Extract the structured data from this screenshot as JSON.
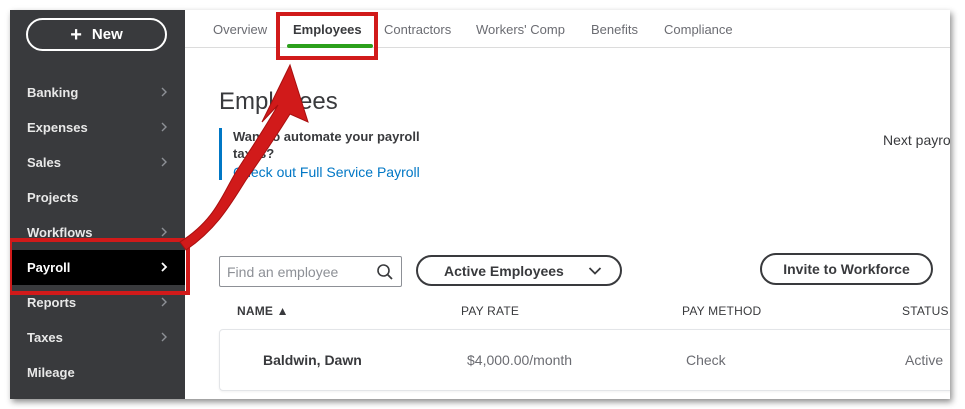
{
  "sidebar": {
    "new_label": "New",
    "items": [
      {
        "label": "Banking"
      },
      {
        "label": "Expenses"
      },
      {
        "label": "Sales"
      },
      {
        "label": "Projects"
      },
      {
        "label": "Workflows"
      },
      {
        "label": "Payroll",
        "active": true
      },
      {
        "label": "Reports"
      },
      {
        "label": "Taxes"
      },
      {
        "label": "Mileage"
      }
    ]
  },
  "tabs": [
    {
      "label": "Overview"
    },
    {
      "label": "Employees",
      "active": true
    },
    {
      "label": "Contractors"
    },
    {
      "label": "Workers' Comp"
    },
    {
      "label": "Benefits"
    },
    {
      "label": "Compliance"
    }
  ],
  "main": {
    "title": "Employees",
    "promo_text": "Want to automate your payroll taxes?",
    "promo_link": "Check out Full Service Payroll",
    "next_payroll": "Next payro",
    "search_placeholder": "Find an employee",
    "filter_label": "Active Employees",
    "invite_label": "Invite to Workforce",
    "columns": {
      "name": "NAME ▲",
      "pay_rate": "PAY RATE",
      "pay_method": "PAY METHOD",
      "status": "STATUS"
    },
    "rows": [
      {
        "name": "Baldwin, Dawn",
        "pay_rate": "$4,000.00/month",
        "pay_method": "Check",
        "status": "Active"
      }
    ]
  },
  "colors": {
    "sidebar_bg": "#393a3d",
    "highlight": "#d11a1a",
    "tab_accent": "#2ca01c",
    "link": "#0077c5"
  }
}
